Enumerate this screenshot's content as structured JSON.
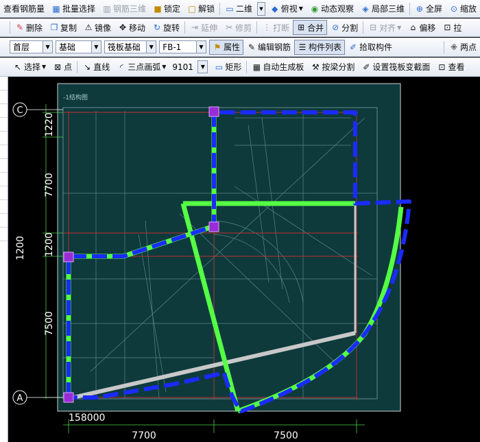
{
  "toolbar1": {
    "view_rebar_qty": "查看钢筋量",
    "batch_select": "批量选择",
    "rebar_3d": "钢筋三维",
    "lock": "锁定",
    "unlock": "解锁",
    "view_mode": "二维",
    "top_view": "俯视",
    "dynamic_view": "动态观察",
    "local_3d": "局部三维",
    "fullscreen": "全屏",
    "zoom": "缩放"
  },
  "toolbar2": {
    "delete": "删除",
    "copy": "复制",
    "mirror": "镜像",
    "move": "移动",
    "rotate": "旋转",
    "extend": "延伸",
    "trim": "修剪",
    "break": "打断",
    "merge": "合并",
    "split": "分割",
    "align": "对齐",
    "offset": "偏移",
    "stretch": "拉"
  },
  "toolbar3": {
    "floor": "首层",
    "category": "基础",
    "element_type": "筏板基础",
    "element_name": "FB-1",
    "properties": "属性",
    "edit_rebar": "编辑钢筋",
    "component_list": "构件列表",
    "pick_component": "拾取构件",
    "two_point": "两点"
  },
  "toolbar4": {
    "select": "选择",
    "point": "点",
    "line": "直线",
    "three_point_arc": "三点画弧",
    "arc_value": "9101",
    "rectangle": "矩形",
    "auto_generate_slab": "自动生成板",
    "split_by_beam": "按梁分割",
    "set_raft_section": "设置筏板变截面",
    "view": "查看"
  },
  "drawing": {
    "axis_c": "C",
    "axis_a": "A",
    "dim_1220": "1220",
    "dim_7700_v": "7700",
    "dim_1200_a": "1200",
    "dim_1200_b": "1200",
    "dim_7500_v": "7500",
    "dim_158000": "158000",
    "dim_7700_h": "7700",
    "dim_7500_h": "7500",
    "title_text": "-1结构图"
  },
  "colors": {
    "drawing_bg": "#0e3a3c",
    "boundary_green": "#55ff44",
    "dash_blue": "#1a2bff",
    "grid_red": "#c03030",
    "node_purple": "#9a2cd6"
  }
}
